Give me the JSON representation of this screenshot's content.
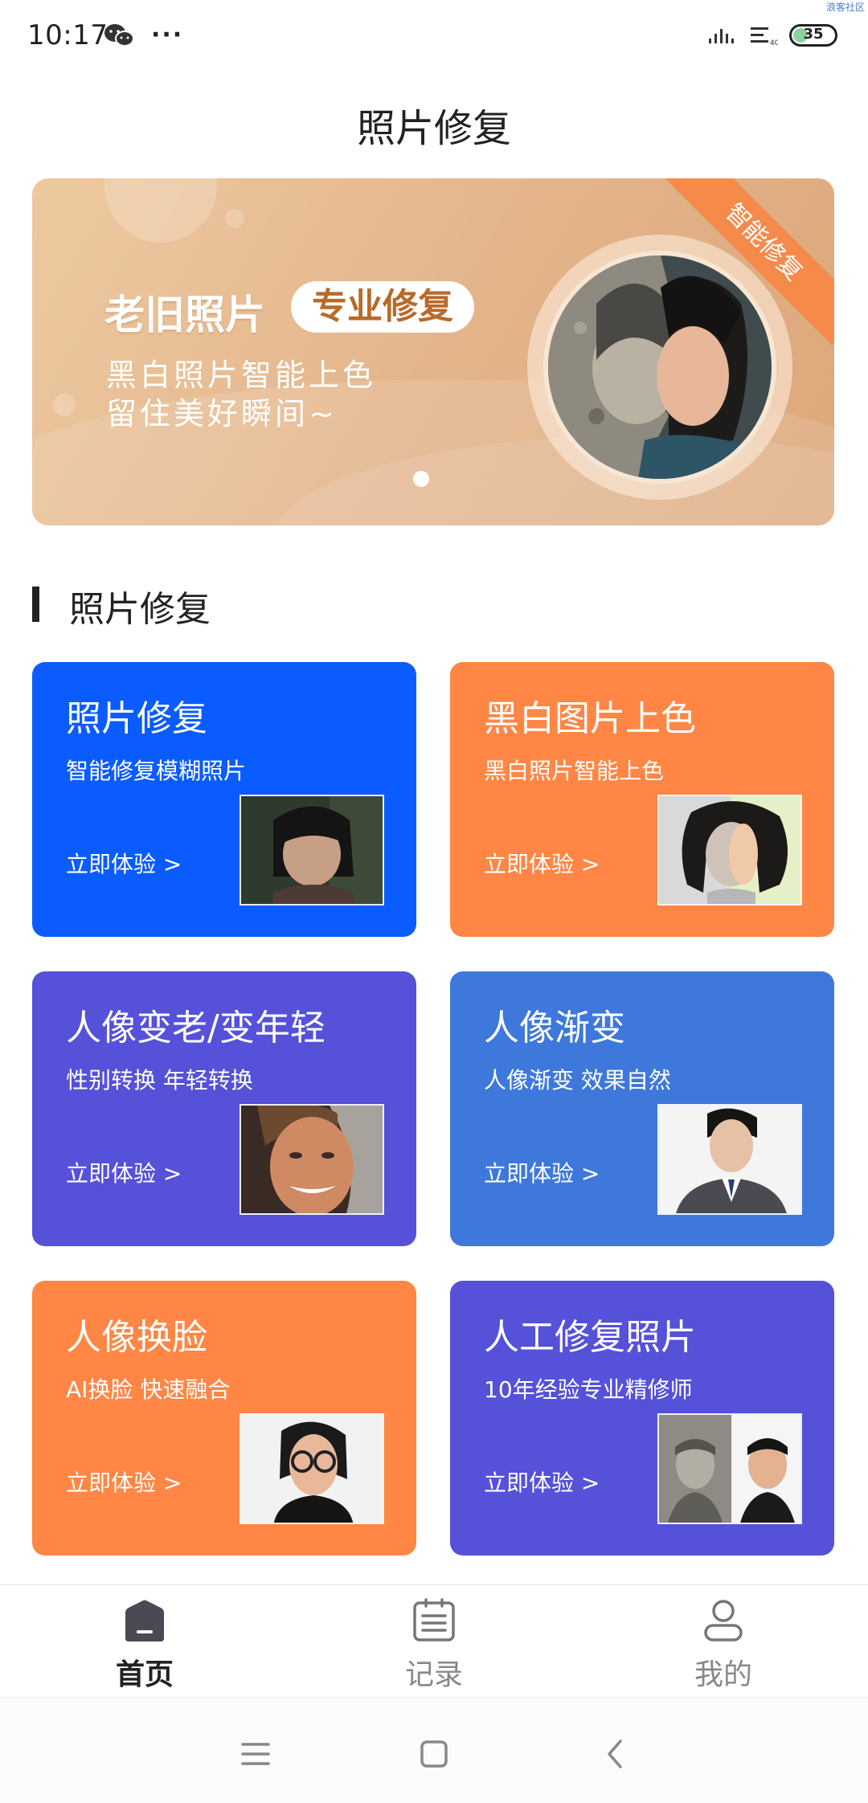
{
  "status_bar": {
    "time": "10:17",
    "more": "···",
    "battery": "35",
    "battery_level": 0.35,
    "watermark": "浪客社区"
  },
  "page_title": "照片修复",
  "banner": {
    "headline": "老旧照片",
    "tag": "专业修复",
    "line1": "黑白照片智能上色",
    "line2": "留住美好瞬间~",
    "ribbon": "智能修复"
  },
  "section": {
    "title": "照片修复"
  },
  "cards": [
    {
      "title": "照片修复",
      "subtitle": "智能修复模糊照片",
      "link": "立即体验 >",
      "color": "#0a5cff"
    },
    {
      "title": "黑白图片上色",
      "subtitle": "黑白照片智能上色",
      "link": "立即体验 >",
      "color": "#ff8644"
    },
    {
      "title": "人像变老/变年轻",
      "subtitle": "性别转换 年轻转换",
      "link": "立即体验 >",
      "color": "#5551d9"
    },
    {
      "title": "人像渐变",
      "subtitle": "人像渐变 效果自然",
      "link": "立即体验 >",
      "color": "#3e78db"
    },
    {
      "title": "人像换脸",
      "subtitle": "AI换脸 快速融合",
      "link": "立即体验 >",
      "color": "#ff8644"
    },
    {
      "title": "人工修复照片",
      "subtitle": "10年经验专业精修师",
      "link": "立即体验 >",
      "color": "#5551d9"
    }
  ],
  "bottom_nav": [
    {
      "label": "首页",
      "icon": "home-icon",
      "active": true
    },
    {
      "label": "记录",
      "icon": "record-icon",
      "active": false
    },
    {
      "label": "我的",
      "icon": "profile-icon",
      "active": false
    }
  ]
}
